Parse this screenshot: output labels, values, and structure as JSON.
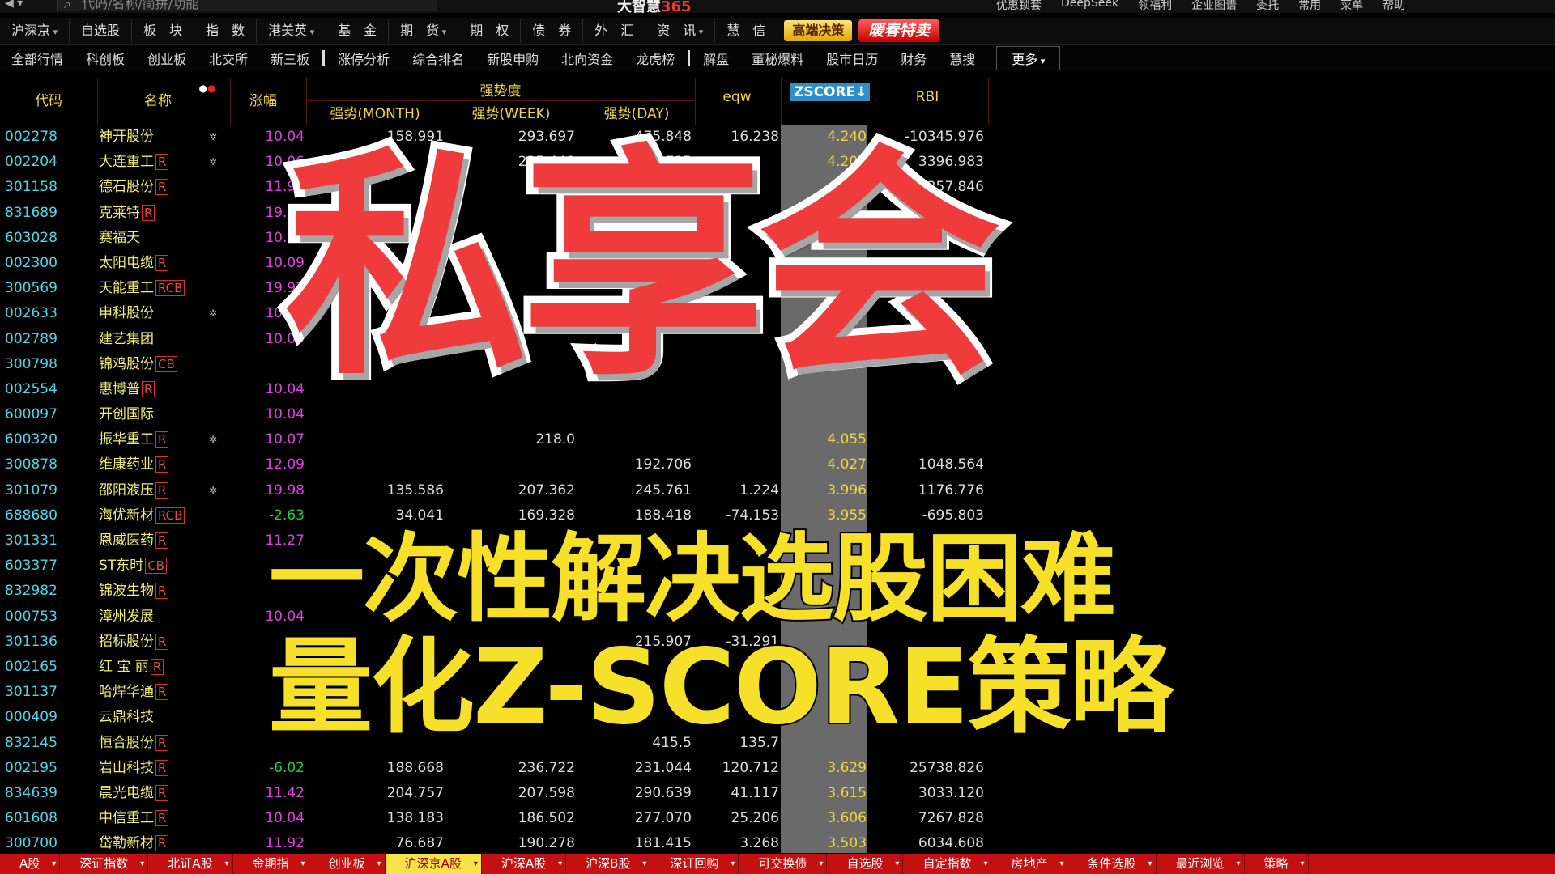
{
  "window": {
    "search_placeholder": "代码/名称/简拼/功能",
    "app_name": "大智慧",
    "app_version": "365",
    "right_menu": [
      "优惠锁套",
      "DeepSeek",
      "领福利",
      "企业图谱",
      "委托",
      "常用",
      "菜单",
      "帮助"
    ]
  },
  "menu1": {
    "items": [
      {
        "label": "沪深京",
        "dd": true
      },
      {
        "label": "自选股",
        "dd": false
      },
      {
        "label": "板　块",
        "dd": false
      },
      {
        "label": "指　数",
        "dd": false
      },
      {
        "label": "港美英",
        "dd": true
      },
      {
        "label": "基　金",
        "dd": false
      },
      {
        "label": "期　货",
        "dd": true
      },
      {
        "label": "期　权",
        "dd": false
      },
      {
        "label": "债　券",
        "dd": false
      },
      {
        "label": "外　汇",
        "dd": false
      },
      {
        "label": "资　讯",
        "dd": true
      },
      {
        "label": "慧　信",
        "dd": false
      }
    ],
    "highlight": "高端决策",
    "promo": "暖春特卖"
  },
  "menu2": {
    "items_left": [
      "全部行情",
      "科创板",
      "创业板",
      "北交所",
      "新三板"
    ],
    "items_mid": [
      "涨停分析",
      "综合排名",
      "新股申购",
      "北向资金",
      "龙虎榜"
    ],
    "items_right": [
      "解盘",
      "董秘爆料",
      "股市日历",
      "财务",
      "慧搜"
    ],
    "more": "更多"
  },
  "table": {
    "headers": {
      "code": "代码",
      "name": "名称",
      "change": "涨幅",
      "strength_group": "强势度",
      "month": "强势(MONTH)",
      "week": "强势(WEEK)",
      "day": "强势(DAY)",
      "eqw": "eqw",
      "zscore": "ZSCORE↓",
      "rbi": "RBI"
    },
    "rows": [
      {
        "code": "002278",
        "name": "神开股份",
        "tag": "",
        "flag": "✲",
        "chg": "10.04",
        "m": "158.991",
        "w": "293.697",
        "d": "475.848",
        "e": "16.238",
        "z": "4.240",
        "r": "-10345.976"
      },
      {
        "code": "002204",
        "name": "大连重工",
        "tag": "R",
        "flag": "✲",
        "chg": "10.06",
        "m": "",
        "w": "235.449",
        "d": "287.715",
        "e": "",
        "z": "4.206",
        "r": "3396.983"
      },
      {
        "code": "301158",
        "name": "德石股份",
        "tag": "R",
        "flag": "",
        "chg": "11.93",
        "m": "",
        "w": "",
        "d": "",
        "e": "",
        "z": "",
        "r": "4357.846"
      },
      {
        "code": "831689",
        "name": "克莱特",
        "tag": "R",
        "flag": "",
        "chg": "19.93",
        "m": "",
        "w": "",
        "d": "",
        "e": "",
        "z": "",
        "r": ""
      },
      {
        "code": "603028",
        "name": "赛福天",
        "tag": "",
        "flag": "",
        "chg": "10.07",
        "m": "",
        "w": "",
        "d": "",
        "e": "",
        "z": "",
        "r": ""
      },
      {
        "code": "002300",
        "name": "太阳电缆",
        "tag": "R",
        "flag": "",
        "chg": "10.09",
        "m": "",
        "w": "",
        "d": "",
        "e": "",
        "z": "",
        "r": ""
      },
      {
        "code": "300569",
        "name": "天能重工",
        "tag": "RCB",
        "flag": "",
        "chg": "19.92",
        "m": "",
        "w": "",
        "d": "",
        "e": "",
        "z": "",
        "r": ""
      },
      {
        "code": "002633",
        "name": "申科股份",
        "tag": "",
        "flag": "✲",
        "chg": "10.02",
        "m": "",
        "w": "",
        "d": "",
        "e": "",
        "z": "",
        "r": ""
      },
      {
        "code": "002789",
        "name": "建艺集团",
        "tag": "",
        "flag": "",
        "chg": "10.05",
        "m": "",
        "w": "",
        "d": "",
        "e": "",
        "z": "",
        "r": ""
      },
      {
        "code": "300798",
        "name": "锦鸡股份",
        "tag": "CB",
        "flag": "",
        "chg": "",
        "m": "",
        "w": "",
        "d": "",
        "e": "",
        "z": "",
        "r": ""
      },
      {
        "code": "002554",
        "name": "惠博普",
        "tag": "R",
        "flag": "",
        "chg": "10.04",
        "m": "",
        "w": "",
        "d": "",
        "e": "",
        "z": "",
        "r": ""
      },
      {
        "code": "600097",
        "name": "开创国际",
        "tag": "",
        "flag": "",
        "chg": "10.04",
        "m": "",
        "w": "",
        "d": "",
        "e": "",
        "z": "",
        "r": ""
      },
      {
        "code": "600320",
        "name": "振华重工",
        "tag": "R",
        "flag": "✲",
        "chg": "10.07",
        "m": "",
        "w": "218.0",
        "d": "",
        "e": "",
        "z": "4.055",
        "r": ""
      },
      {
        "code": "300878",
        "name": "维康药业",
        "tag": "R",
        "flag": "",
        "chg": "12.09",
        "m": "",
        "w": "",
        "d": "192.706",
        "e": "",
        "z": "4.027",
        "r": "1048.564"
      },
      {
        "code": "301079",
        "name": "邵阳液压",
        "tag": "R",
        "flag": "✲",
        "chg": "19.98",
        "m": "135.586",
        "w": "207.362",
        "d": "245.761",
        "e": "1.224",
        "z": "3.996",
        "r": "1176.776"
      },
      {
        "code": "688680",
        "name": "海优新材",
        "tag": "RCB",
        "flag": "",
        "chg": "-2.63",
        "m": "34.041",
        "w": "169.328",
        "d": "188.418",
        "e": "-74.153",
        "z": "3.955",
        "r": "-695.803"
      },
      {
        "code": "301331",
        "name": "恩威医药",
        "tag": "R",
        "flag": "",
        "chg": "11.27",
        "m": "",
        "w": "",
        "d": "",
        "e": "",
        "z": "",
        "r": ""
      },
      {
        "code": "603377",
        "name": "ST东时",
        "tag": "CB",
        "flag": "",
        "chg": "",
        "m": "",
        "w": "",
        "d": "",
        "e": "",
        "z": "",
        "r": ""
      },
      {
        "code": "832982",
        "name": "锦波生物",
        "tag": "R",
        "flag": "",
        "chg": "",
        "m": "",
        "w": "",
        "d": "",
        "e": "",
        "z": "",
        "r": ""
      },
      {
        "code": "000753",
        "name": "漳州发展",
        "tag": "",
        "flag": "",
        "chg": "10.04",
        "m": "",
        "w": "",
        "d": "",
        "e": "",
        "z": "",
        "r": ""
      },
      {
        "code": "301136",
        "name": "招标股份",
        "tag": "R",
        "flag": "",
        "chg": "",
        "m": "",
        "w": "",
        "d": "215.907",
        "e": "-31.291",
        "z": "",
        "r": ""
      },
      {
        "code": "002165",
        "name": "红 宝 丽",
        "tag": "R",
        "flag": "",
        "chg": "",
        "m": "",
        "w": "",
        "d": "",
        "e": "",
        "z": "",
        "r": ""
      },
      {
        "code": "301137",
        "name": "哈焊华通",
        "tag": "R",
        "flag": "",
        "chg": "",
        "m": "",
        "w": "",
        "d": "",
        "e": "",
        "z": "",
        "r": ""
      },
      {
        "code": "000409",
        "name": "云鼎科技",
        "tag": "",
        "flag": "",
        "chg": "",
        "m": "",
        "w": "",
        "d": "",
        "e": "",
        "z": "",
        "r": ""
      },
      {
        "code": "832145",
        "name": "恒合股份",
        "tag": "R",
        "flag": "",
        "chg": "",
        "m": "",
        "w": "",
        "d": "415.5",
        "e": "135.7",
        "z": "",
        "r": ""
      },
      {
        "code": "002195",
        "name": "岩山科技",
        "tag": "R",
        "flag": "",
        "chg": "-6.02",
        "m": "188.668",
        "w": "236.722",
        "d": "231.044",
        "e": "120.712",
        "z": "3.629",
        "r": "25738.826"
      },
      {
        "code": "834639",
        "name": "晨光电缆",
        "tag": "R",
        "flag": "",
        "chg": "11.42",
        "m": "204.757",
        "w": "207.598",
        "d": "290.639",
        "e": "41.117",
        "z": "3.615",
        "r": "3033.120"
      },
      {
        "code": "601608",
        "name": "中信重工",
        "tag": "R",
        "flag": "",
        "chg": "10.04",
        "m": "138.183",
        "w": "186.502",
        "d": "277.070",
        "e": "25.206",
        "z": "3.606",
        "r": "7267.828"
      },
      {
        "code": "300700",
        "name": "岱勒新材",
        "tag": "R",
        "flag": "",
        "chg": "11.92",
        "m": "76.687",
        "w": "190.278",
        "d": "181.415",
        "e": "3.268",
        "z": "3.503",
        "r": "6034.608"
      }
    ]
  },
  "bottom_tabs": [
    {
      "label": "A股",
      "active": false
    },
    {
      "label": "深证指数",
      "active": false
    },
    {
      "label": "北证A股",
      "active": false
    },
    {
      "label": "金期指",
      "active": false
    },
    {
      "label": "创业板",
      "active": false
    },
    {
      "label": "沪深京A股",
      "active": true
    },
    {
      "label": "沪深A股",
      "active": false
    },
    {
      "label": "沪深B股",
      "active": false
    },
    {
      "label": "深证回购",
      "active": false
    },
    {
      "label": "可交换债",
      "active": false
    },
    {
      "label": "自选股",
      "active": false
    },
    {
      "label": "自定指数",
      "active": false
    },
    {
      "label": "房地产",
      "active": false
    },
    {
      "label": "条件选股",
      "active": false
    },
    {
      "label": "最近浏览",
      "active": false
    },
    {
      "label": "策略",
      "active": false
    }
  ],
  "overlay": {
    "big": "私享会",
    "line1": "一次性解决选股困难",
    "line2": "量化Z-SCORE策略"
  },
  "colors": {
    "accent_red": "#ef3b3b",
    "headline_yellow": "#f7e02a",
    "code_cyan": "#4fd6e8",
    "name_yellow": "#f0ec75",
    "up_magenta": "#e040e0",
    "down_green": "#20d040"
  }
}
